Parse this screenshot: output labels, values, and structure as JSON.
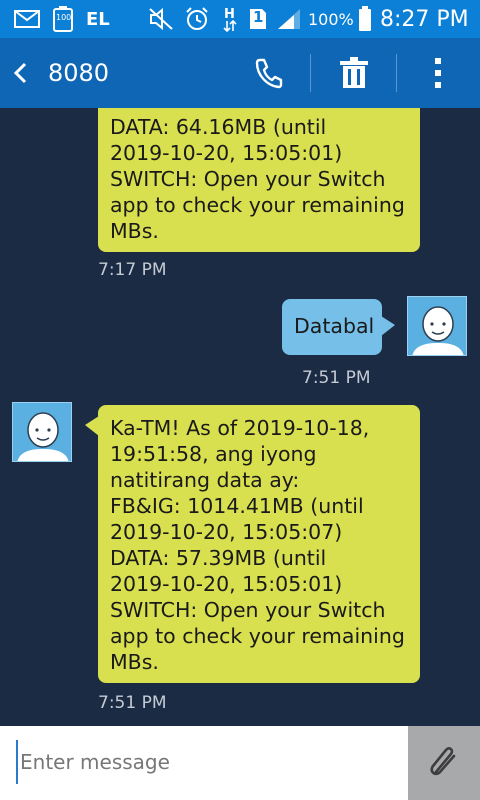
{
  "status_bar": {
    "battery_level": "100",
    "carrier_label": "EL",
    "sim_slot": "1",
    "battery_percent": "100%",
    "time": "8:27 PM",
    "icons": [
      "mail-icon",
      "battery-100-icon",
      "no-sound-icon",
      "alarm-icon",
      "data-transfer-icon",
      "sim-1-icon",
      "signal-icon",
      "battery-icon"
    ]
  },
  "header": {
    "title": "8080",
    "back_icon": "back-chevron-icon",
    "actions": [
      "phone-icon",
      "trash-icon",
      "more-vert-icon"
    ]
  },
  "messages": [
    {
      "direction": "incoming",
      "lines": [
        "DATA: 64.16MB (until",
        "2019-10-20, 15:05:01)",
        "SWITCH: Open your Switch",
        "app to check your remaining",
        "MBs."
      ],
      "time": "7:17 PM"
    },
    {
      "direction": "outgoing",
      "lines": [
        "Databal"
      ],
      "time": "7:51 PM"
    },
    {
      "direction": "incoming",
      "lines": [
        "Ka-TM! As of 2019-10-18,",
        "19:51:58, ang iyong",
        "natitirang data ay:",
        "FB&IG: 1014.41MB (until",
        "2019-10-20, 15:05:07)",
        "DATA: 57.39MB (until",
        "2019-10-20, 15:05:01)",
        "SWITCH: Open your Switch",
        "app to check your remaining",
        "MBs."
      ],
      "time": "7:51 PM"
    }
  ],
  "compose": {
    "placeholder": "Enter message",
    "attach_icon": "paperclip-icon"
  },
  "colors": {
    "status_bar": "#0c80d6",
    "action_bar": "#0f66b4",
    "background": "#1b2b44",
    "incoming_bubble": "#d9e04f",
    "outgoing_bubble": "#75bfe9",
    "attach_button": "#a8a9ab"
  }
}
